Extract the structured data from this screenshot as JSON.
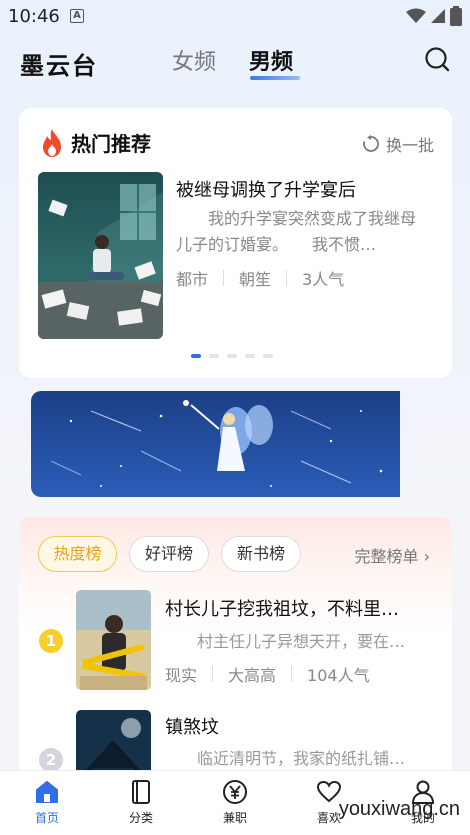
{
  "status_bar": {
    "time": "10:46",
    "notification_glyph": "A"
  },
  "header": {
    "app_name": "墨云台",
    "tabs": [
      {
        "label": "女频",
        "active": false
      },
      {
        "label": "男频",
        "active": true
      }
    ]
  },
  "hot": {
    "title": "热门推荐",
    "refresh_label": "换一批",
    "book": {
      "title": "被继母调换了升学宴后",
      "desc": "我的升学宴突然变成了我继母儿子的订婚宴。　　我不惯…",
      "meta": [
        "都市",
        "朝笙",
        "3人气"
      ]
    },
    "carousel": {
      "count": 5,
      "active_index": 0
    }
  },
  "ranking": {
    "chips": [
      "热度榜",
      "好评榜",
      "新书榜"
    ],
    "active_chip": 0,
    "full_list_label": "完整榜单",
    "items": [
      {
        "rank": "1",
        "title": "村长儿子挖我祖坟，不料里…",
        "desc": "村主任儿子异想天开，要在…",
        "meta": [
          "现实",
          "大高高",
          "104人气"
        ]
      },
      {
        "rank": "2",
        "title": "镇煞坟",
        "desc": "临近清明节，我家的纸扎铺…",
        "meta": []
      }
    ]
  },
  "bottom_nav": [
    {
      "label": "首页",
      "icon": "home-icon",
      "active": true
    },
    {
      "label": "分类",
      "icon": "book-icon",
      "active": false
    },
    {
      "label": "兼职",
      "icon": "yen-icon",
      "active": false
    },
    {
      "label": "喜欢",
      "icon": "heart-icon",
      "active": false
    },
    {
      "label": "我的",
      "icon": "user-icon",
      "active": false
    }
  ],
  "watermark": "youxiwang.cn",
  "colors": {
    "accent": "#2f6ee4",
    "rank_gold": "#f7ce2a",
    "chip_hot": "#e8a317"
  }
}
